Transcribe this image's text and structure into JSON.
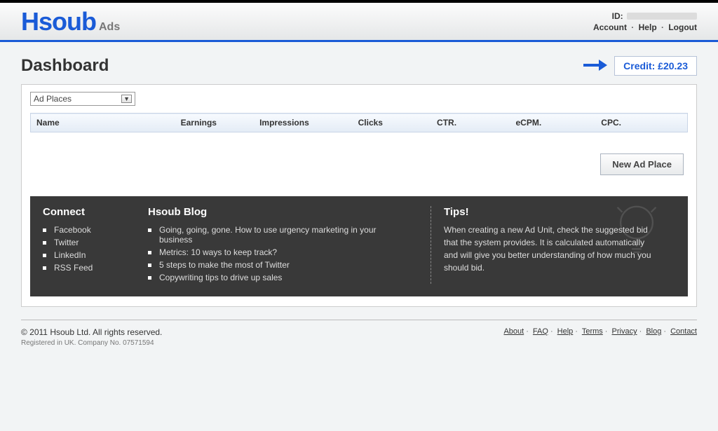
{
  "header": {
    "logo_main": "Hsoub",
    "logo_sub": "Ads",
    "id_label": "ID:",
    "links": {
      "account": "Account",
      "help": "Help",
      "logout": "Logout"
    }
  },
  "page": {
    "title": "Dashboard",
    "credit_label": "Credit: £20.23"
  },
  "filter": {
    "selected": "Ad Places"
  },
  "table": {
    "columns": [
      "Name",
      "Earnings",
      "Impressions",
      "Clicks",
      "CTR.",
      "eCPM.",
      "CPC."
    ]
  },
  "actions": {
    "new_ad_place": "New Ad Place"
  },
  "connect": {
    "title": "Connect",
    "items": [
      "Facebook",
      "Twitter",
      "LinkedIn",
      "RSS Feed"
    ]
  },
  "blog": {
    "title": "Hsoub Blog",
    "items": [
      "Going, going, gone. How to use urgency marketing in your business",
      "Metrics: 10 ways to keep track?",
      "5 steps to make the most of Twitter",
      "Copywriting tips to drive up sales"
    ]
  },
  "tips": {
    "title": "Tips!",
    "body": "When creating a new Ad Unit, check the suggested bid that the system provides. It is calculated automatically and will give you better understanding of how much you should bid."
  },
  "footer": {
    "copyright": "© 2011 Hsoub Ltd. All rights reserved.",
    "registered": "Registered in UK. Company No. 07571594",
    "links": [
      "About",
      "FAQ",
      "Help",
      "Terms",
      "Privacy",
      "Blog",
      "Contact"
    ]
  }
}
